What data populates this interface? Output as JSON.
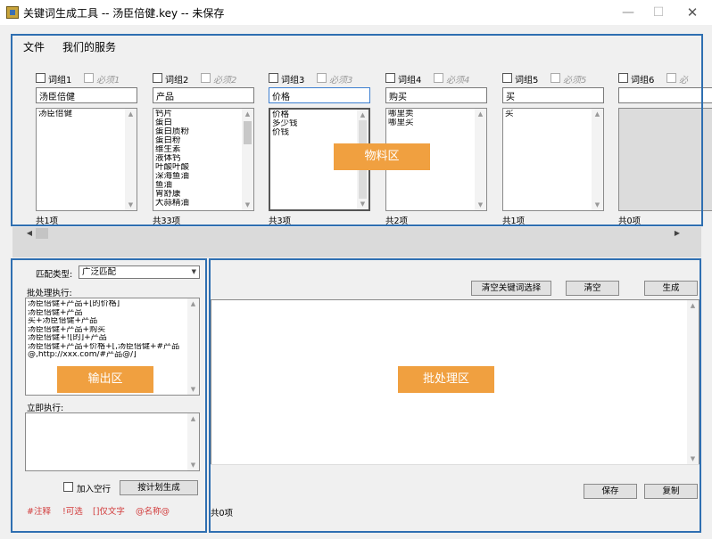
{
  "window": {
    "title": "关键词生成工具 -- 汤臣倍健.key -- 未保存",
    "icon": "app-icon"
  },
  "menu": {
    "items": [
      "文件",
      "我们的服务"
    ]
  },
  "groups": [
    {
      "checkbox_label": "词组1",
      "required_label": "必须1",
      "name": "汤臣倍健",
      "items": [
        "汤臣倍健"
      ],
      "count": "共1项",
      "thumb": 0
    },
    {
      "checkbox_label": "词组2",
      "required_label": "必须2",
      "name": "产品",
      "items": [
        "钙片",
        "蛋白",
        "蛋白质粉",
        "蛋白粉",
        "维生素",
        "液体钙",
        "叶酸叶酸",
        "深海鱼油",
        "鱼油",
        "胃舒康",
        "大蒜精油"
      ],
      "count": "共33项",
      "thumb": 1
    },
    {
      "checkbox_label": "词组3",
      "required_label": "必须3",
      "name": "价格",
      "items": [
        "价格",
        "多少钱",
        "价钱"
      ],
      "count": "共3项",
      "thumb": 2
    },
    {
      "checkbox_label": "词组4",
      "required_label": "必须4",
      "name": "购买",
      "items": [
        "哪里卖",
        "哪里买"
      ],
      "count": "共2项",
      "thumb": 0
    },
    {
      "checkbox_label": "词组5",
      "required_label": "必须5",
      "name": "买",
      "items": [
        "买"
      ],
      "count": "共1项",
      "thumb": 0
    },
    {
      "checkbox_label": "词组6",
      "required_label": "必",
      "name": "",
      "items": [],
      "count": "共0项",
      "thumb": 0
    }
  ],
  "regions": {
    "material": "物料区",
    "output": "输出区",
    "batch": "批处理区"
  },
  "output_panel": {
    "match_type_label": "匹配类型:",
    "match_type_value": "广泛匹配",
    "batch_label": "批处理执行:",
    "batch_lines": [
      "汤臣倍健+产品+[的价格]",
      "汤臣倍健+产品",
      "买+汤臣倍健+产品",
      "汤臣倍健+产品+购买",
      "汤臣倍健+![的]+产品",
      "汤臣倍健+产品+价格+[,汤臣倍健+#产品",
      "@,http://xxx.com/#产品@/]"
    ],
    "immediate_label": "立即执行:",
    "add_blank_label": "加入空行",
    "plan_button": "按计划生成",
    "legend": [
      "#注释",
      "!可选",
      "[]仅文字",
      "@名称@"
    ]
  },
  "batch_panel": {
    "clear_selection_button": "清空关键词选择",
    "clear_button": "清空",
    "generate_button": "生成",
    "save_button": "保存",
    "copy_button": "复制",
    "result_count": "共0项"
  },
  "colors": {
    "region_border": "#2f6fb1",
    "tag_bg": "#f0a040",
    "legend_red": "#d23b3b"
  }
}
